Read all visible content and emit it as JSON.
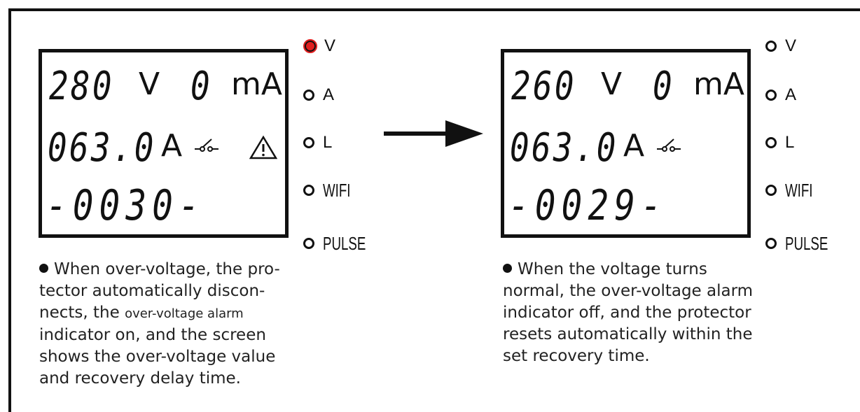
{
  "left_panel": {
    "display": {
      "voltage_value": "280",
      "voltage_unit": "V",
      "current_value": "0",
      "current_unit": "mA",
      "amp_value": "063.0",
      "amp_unit": "A",
      "delay_value": "-0030-"
    },
    "indicators": [
      {
        "label": "V",
        "state": "on"
      },
      {
        "label": "A",
        "state": "off"
      },
      {
        "label": "L",
        "state": "off"
      },
      {
        "label": "WIFI",
        "state": "off"
      },
      {
        "label": "PULSE",
        "state": "off"
      }
    ],
    "caption": {
      "line1_a": "When over-voltage, the pro-",
      "line2": "tector automatically discon-",
      "line3_a": "nects, the ",
      "line3_b": "over-voltage alarm",
      "line4": "indicator on, and the screen",
      "line5": "shows the over-voltage value",
      "line6": "and recovery delay time."
    }
  },
  "right_panel": {
    "display": {
      "voltage_value": "260",
      "voltage_unit": "V",
      "current_value": "0",
      "current_unit": "mA",
      "amp_value": "063.0",
      "amp_unit": "A",
      "delay_value": "-0029-"
    },
    "indicators": [
      {
        "label": "V",
        "state": "off"
      },
      {
        "label": "A",
        "state": "off"
      },
      {
        "label": "L",
        "state": "off"
      },
      {
        "label": "WIFI",
        "state": "off"
      },
      {
        "label": "PULSE",
        "state": "off"
      }
    ],
    "caption": {
      "line1": "When the voltage turns",
      "line2": "normal, the over-voltage alarm",
      "line3": "indicator off, and the protector",
      "line4": "resets automatically within the",
      "line5": "set recovery time."
    }
  },
  "colors": {
    "alarm_on": "#e02020",
    "ink": "#111111"
  }
}
